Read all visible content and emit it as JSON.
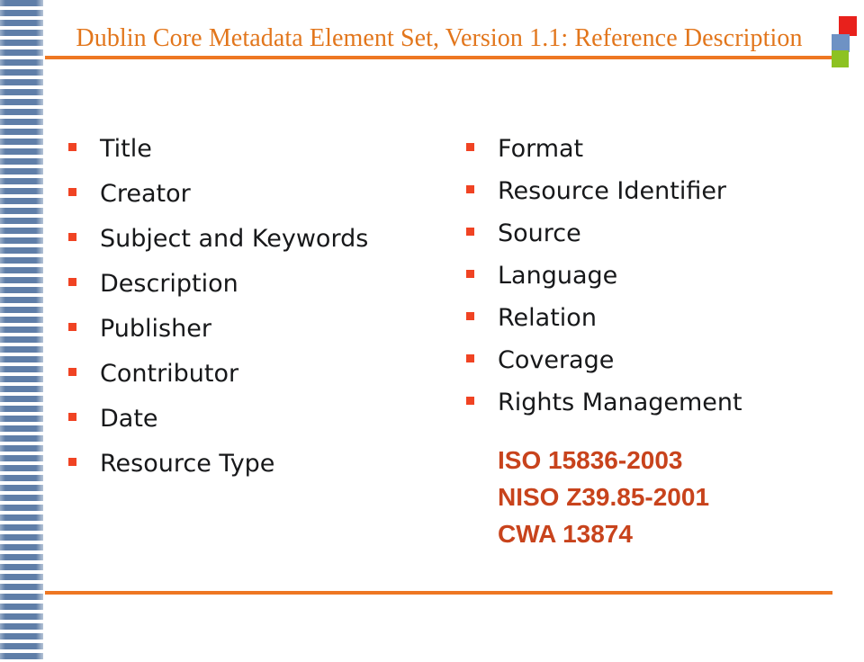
{
  "slide": {
    "title": "Dublin Core Metadata Element Set, Version 1.1: Reference Description",
    "colors": {
      "title_orange": "#e2761c",
      "rule_orange": "#ee7722",
      "bullet_red": "#f04323",
      "standards_red": "#c8431c",
      "band_blue": "#5f7ea8",
      "deco_red": "#e8211c",
      "deco_blue": "#6e92c4",
      "deco_green": "#8dc222",
      "body_text": "#17181a"
    }
  },
  "columns": {
    "left": {
      "items": [
        {
          "label": "Title"
        },
        {
          "label": "Creator"
        },
        {
          "label": "Subject and Keywords"
        },
        {
          "label": "Description"
        },
        {
          "label": "Publisher"
        },
        {
          "label": "Contributor"
        },
        {
          "label": "Date"
        },
        {
          "label": "Resource Type"
        }
      ]
    },
    "right": {
      "items": [
        {
          "label": "Format"
        },
        {
          "label": "Resource Identifier"
        },
        {
          "label": "Source"
        },
        {
          "label": "Language"
        },
        {
          "label": "Relation"
        },
        {
          "label": "Coverage"
        },
        {
          "label": "Rights Management"
        }
      ]
    }
  },
  "standards": {
    "lines": [
      "ISO 15836-2003",
      "NISO Z39.85-2001",
      "CWA 13874"
    ]
  },
  "decorations": {
    "square_red": "red-square",
    "square_blue": "blue-square",
    "square_green": "green-square",
    "side_band": "striped-side-band"
  }
}
